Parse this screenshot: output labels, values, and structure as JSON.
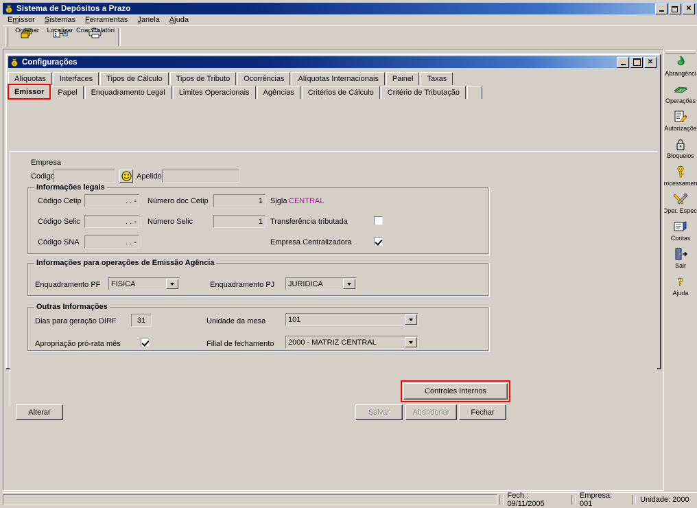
{
  "window": {
    "title": "Sistema de Depósitos a Prazo",
    "icon": "money-bag-icon",
    "minimize": "minimize-icon",
    "restore": "restore-icon",
    "close": "close-icon"
  },
  "menubar": {
    "items": [
      {
        "label": "Emissor",
        "accel": "m"
      },
      {
        "label": "Sistemas",
        "accel": "S"
      },
      {
        "label": "Ferramentas",
        "accel": "F"
      },
      {
        "label": "Janela",
        "accel": "J"
      },
      {
        "label": "Ajuda",
        "accel": "A"
      }
    ]
  },
  "toolbar": {
    "buttons": [
      {
        "label": "Ordenar",
        "icon": "sort-cards-icon"
      },
      {
        "label": "Localizar",
        "icon": "find-list-icon"
      },
      {
        "label": "Criar Relatóri",
        "icon": "printer-icon"
      }
    ]
  },
  "right_dock": {
    "buttons": [
      {
        "label": "Abrangênci",
        "icon": "recycle-globe-icon"
      },
      {
        "label": "Operações",
        "icon": "money-icon"
      },
      {
        "label": "Autorizaçõe",
        "icon": "document-pencil-icon"
      },
      {
        "label": "Bloqueios",
        "icon": "padlock-icon"
      },
      {
        "label": "rocessamen",
        "icon": "key-icon"
      },
      {
        "label": "Oper. Especi",
        "icon": "tools-icon"
      },
      {
        "label": "Contas",
        "icon": "account-book-icon"
      },
      {
        "label": "Sair",
        "icon": "exit-door-icon"
      },
      {
        "label": "Ajuda",
        "icon": "question-mark-icon"
      }
    ]
  },
  "dialog": {
    "title": "Configurações",
    "icon": "money-bag-icon",
    "minimize": "minimize-icon",
    "maximize": "maximize-icon",
    "close": "close-icon",
    "tabs_row1": [
      "Alíquotas",
      "Interfaces",
      "Tipos de Cálculo",
      "Tipos de Tributo",
      "Ocorrências",
      "Alíquotas Internacionais",
      "Painel",
      "Taxas"
    ],
    "tabs_row2": [
      "Emissor",
      "Papel",
      "Enquadramento Legal",
      "Limites Operacionais",
      "Agências",
      "Critérios de Cálculo",
      "Critério de Tributação"
    ],
    "selected_tab": "Emissor"
  },
  "form": {
    "empresa": {
      "section_label": "Empresa",
      "codigo_label": "Codigo",
      "codigo_value": "",
      "smiley_icon": "smiley-face-icon",
      "apelido_label": "Apelido",
      "apelido_value": ""
    },
    "informacoes_legais": {
      "caption": "Informações legais",
      "codigo_cetip_label": "Código Cetip",
      "codigo_cetip_value": ". . -",
      "codigo_selic_label": "Código Selic",
      "codigo_selic_value": ". . -",
      "codigo_sna_label": "Código SNA",
      "codigo_sna_value": ". . -",
      "numero_doc_cetip_label": "Número doc Cetip",
      "numero_doc_cetip_value": "1",
      "numero_selic_label": "Número Selic",
      "numero_selic_value": "1",
      "sigla_label": "Sigla",
      "sigla_value": "CENTRAL",
      "sigla_color": "#a0149b",
      "transferencia_label": "Transferência tributada",
      "transferencia_checked": false,
      "centralizadora_label": "Empresa Centralizadora",
      "centralizadora_checked": true
    },
    "emissao_agencia": {
      "caption": "Informações para operações de Emissão Agência",
      "pf_label": "Enquadramento PF",
      "pf_value": "FISICA",
      "pj_label": "Enquadramento PJ",
      "pj_value": "JURIDICA"
    },
    "outras_informacoes": {
      "caption": "Outras Informações",
      "dirf_label": "Dias para geração DIRF",
      "dirf_value": "31",
      "prorata_label": "Apropriação pró-rata mês",
      "prorata_checked": true,
      "unidade_label": "Unidade da mesa",
      "unidade_value": "101",
      "filial_label": "Filial de fechamento",
      "filial_value": "2000 - MATRIZ CENTRAL"
    }
  },
  "buttons": {
    "controles_internos": "Controles Internos",
    "alterar": "Alterar",
    "salvar": "Salvar",
    "abandonar": "Abandonar",
    "fechar": "Fechar",
    "highlight_color": "#ff0000"
  },
  "statusbar": {
    "left_panel": "",
    "fech_label": "Fech.:   09/11/2005",
    "empresa_label": "Empresa: 001",
    "unidade_label": "Unidade: 2000"
  }
}
